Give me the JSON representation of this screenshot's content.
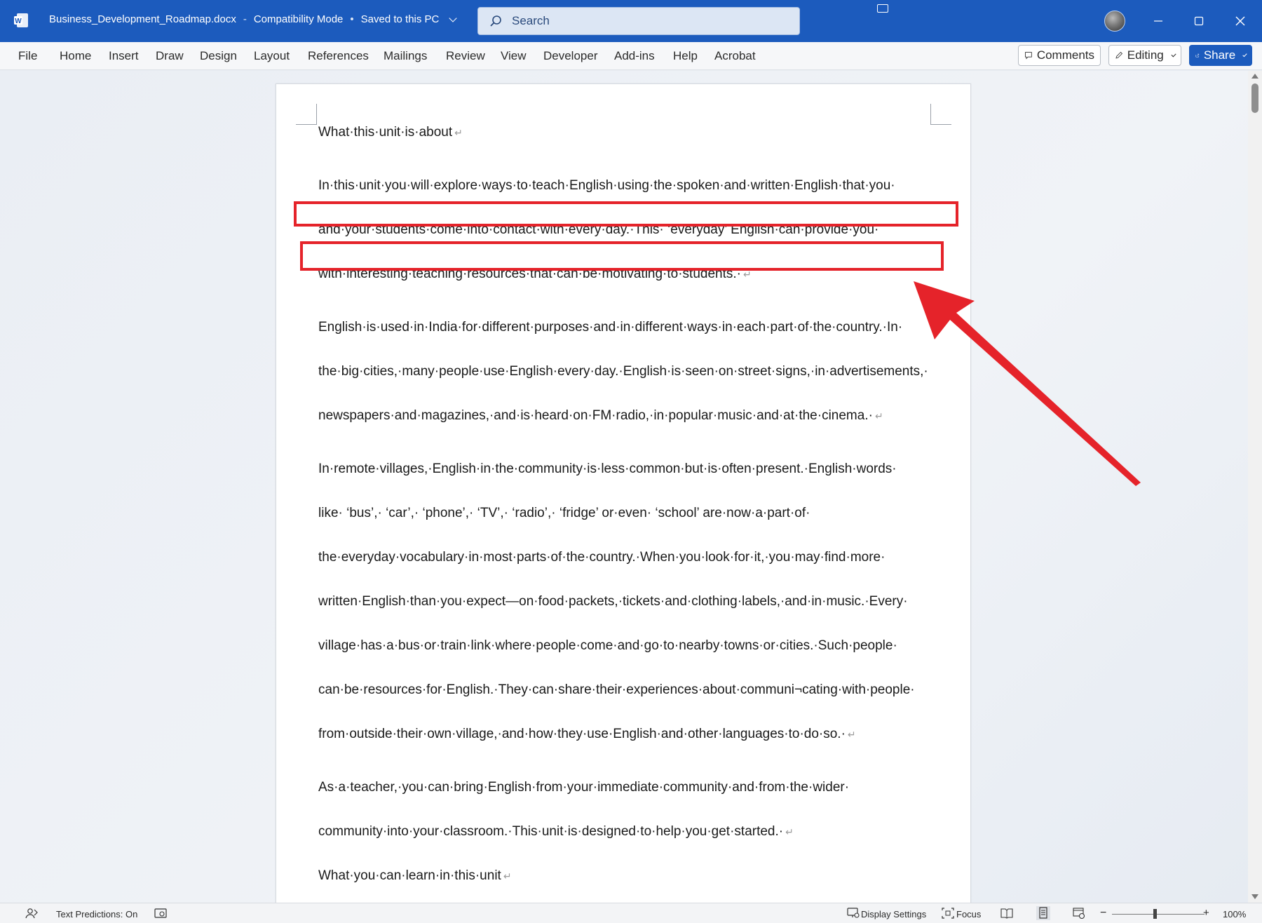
{
  "titlebar": {
    "filename": "Business_Development_Roadmap.docx",
    "separator": "-",
    "mode": "Compatibility Mode",
    "bullet": "•",
    "save_status": "Saved to this PC",
    "search_placeholder": "Search"
  },
  "ribbon": {
    "tabs": [
      "File",
      "Home",
      "Insert",
      "Draw",
      "Design",
      "Layout",
      "References",
      "Mailings",
      "Review",
      "View",
      "Developer",
      "Add-ins",
      "Help",
      "Acrobat"
    ],
    "comments_label": "Comments",
    "editing_label": "Editing",
    "share_label": "Share"
  },
  "document": {
    "heading1": "What·this·unit·is·about",
    "p1": [
      "In·this·unit·you·will·explore·ways·to·teach·English·using·the·spoken·and·written·English·that·you·",
      "and·your·students·come·into·contact·with·every·day.·This· ‘everyday’ English·can·provide·you·",
      "with·interesting·teaching·resources·that·can·be·motivating·to·students.·"
    ],
    "p2": [
      "English·is·used·in·India·for·different·purposes·and·in·different·ways·in·each·part·of·the·country.·In·",
      "the·big·cities,·many·people·use·English·every·day.·English·is·seen·on·street·signs,·in·advertisements,·",
      "newspapers·and·magazines,·and·is·heard·on·FM·radio,·in·popular·music·and·at·the·cinema.·"
    ],
    "p3": [
      "In·remote·villages,·English·in·the·community·is·less·common·but·is·often·present.·English·words·",
      "like· ‘bus’,· ‘car’,· ‘phone’,· ‘TV’,· ‘radio’,· ‘fridge’ or·even· ‘school’ are·now·a·part·of·",
      "the·everyday·vocabulary·in·most·parts·of·the·country.·When·you·look·for·it,·you·may·find·more·",
      "written·English·than·you·expect—on·food·packets,·tickets·and·clothing·labels,·and·in·music.·Every·",
      "village·has·a·bus·or·train·link·where·people·come·and·go·to·nearby·towns·or·cities.·Such·people·",
      "can·be·resources·for·English.·They·can·share·their·experiences·about·communi¬cating·with·people·",
      "from·outside·their·own·village,·and·how·they·use·English·and·other·languages·to·do·so.·"
    ],
    "p4": [
      "As·a·teacher,·you·can·bring·English·from·your·immediate·community·and·from·the·wider·",
      "community·into·your·classroom.·This·unit·is·designed·to·help·you·get·started.·"
    ],
    "heading2": "What·you·can·learn·in·this·unit",
    "paragraph_mark": "↵"
  },
  "statusbar": {
    "text_predictions": "Text Predictions: On",
    "display_settings": "Display Settings",
    "focus": "Focus",
    "zoom_minus": "−",
    "zoom_plus": "+",
    "zoom_level": "100%"
  },
  "colors": {
    "title_bar": "#1c5bbd",
    "annotation_red": "#e5232a"
  }
}
